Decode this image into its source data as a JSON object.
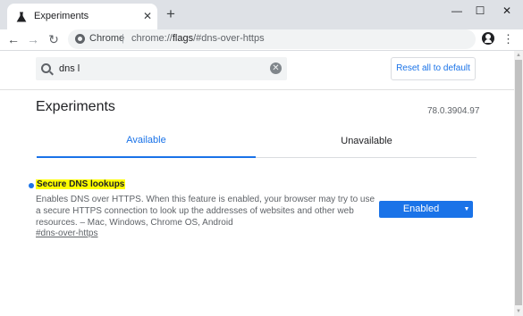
{
  "browser": {
    "tab": {
      "title": "Experiments",
      "icon": "flask-icon",
      "close_glyph": "✕"
    },
    "new_tab_glyph": "+",
    "window_controls": {
      "minimize": "—",
      "maximize": "☐",
      "close": "✕"
    },
    "toolbar": {
      "back_glyph": "←",
      "forward_glyph": "→",
      "reload_glyph": "↻",
      "site_label": "Chrome",
      "separator": "|",
      "url_prefix": "chrome://",
      "url_host": "flags",
      "url_path": "/#dns-over-https",
      "star_glyph": "☆",
      "menu_glyph": "⋮"
    }
  },
  "page": {
    "search": {
      "value": "dns l",
      "clear_glyph": "✕"
    },
    "reset_button": "Reset all to default",
    "title": "Experiments",
    "version": "78.0.3904.97",
    "tabs": [
      {
        "label": "Available",
        "active": true
      },
      {
        "label": "Unavailable",
        "active": false
      }
    ],
    "flag": {
      "name": "Secure DNS lookups",
      "description": "Enables DNS over HTTPS. When this feature is enabled, your browser may try to use a secure HTTPS connection to look up the addresses of websites and other web resources. – Mac, Windows, Chrome OS, Android",
      "link": "#dns-over-https",
      "selected": "Enabled",
      "arrow_glyph": "▼"
    }
  },
  "scrollbar": {
    "up_glyph": "▲",
    "down_glyph": "▼"
  },
  "colors": {
    "accent": "#1a73e8",
    "highlight": "#ffff00",
    "tabstrip": "#dee1e6"
  }
}
